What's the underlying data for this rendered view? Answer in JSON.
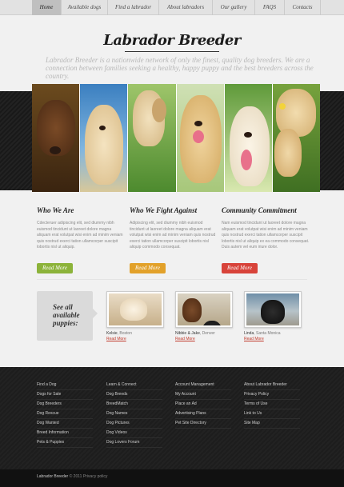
{
  "nav": {
    "items": [
      {
        "label": "Home",
        "active": true
      },
      {
        "label": "Available dogs"
      },
      {
        "label": "Find a labrador"
      },
      {
        "label": "About labradors"
      },
      {
        "label": "Our gallery"
      },
      {
        "label": "FAQS"
      },
      {
        "label": "Contacts"
      }
    ]
  },
  "header": {
    "logo": "Labrador Breeder",
    "tagline": "Labrador Breeder is a nationwide network of only the finest, quality dog breeders. We are a connection between families seeking a healthy, happy puppy and the best breeders across the country."
  },
  "columns": [
    {
      "title": "Who We Are",
      "text": "Cdecteruer adipiscing elit, sed diummy nibh euismod tincidunt ut laoreet dolore magna aliquam erat volutpat wisi enim ad minim veniam quis nostrud exerci tation ullamcorper suscipit lobortis nisl ut aliquip.",
      "button": "Read More",
      "color": "#8cb33a"
    },
    {
      "title": "Who We Fight Against",
      "text": "Adipiscing elit, sed diummy nibh euismod tincidunt ut laoreet dolore magna aliquam erat volutpat wisi enim ad minim veniam quis nostrud exerci tation ullamcorper suscipit lobortis nisl aliquip commodo consequat.",
      "button": "Read More",
      "color": "#e2a12a"
    },
    {
      "title": "Community Commitment",
      "text": "Nam euismod tincidunt ut laoreet dolore magna aliquam erat volutpat wisi enim ad minim veniam quis nostrud exerci tation ullamcorper suscipit lobortis nisl ut aliquip ex ea commodo consequat. Duis autem vel eum iriure dolor.",
      "button": "Read More",
      "color": "#d8433a"
    }
  ],
  "puppies": {
    "heading": "See all available puppies:",
    "items": [
      {
        "name": "Kelsie",
        "location": "Boston",
        "more": "Read More"
      },
      {
        "name": "Nibbie & Jake",
        "location": "Denver",
        "more": "Read More"
      },
      {
        "name": "Linda",
        "location": "Santa Monica",
        "more": "Read More"
      }
    ]
  },
  "footer": {
    "columns": [
      [
        "Find a Dog",
        "Dogs for Sale",
        "Dog Breeders",
        "Dog Rescue",
        "Dog Wanted",
        "Breed Information",
        "Pets & Puppies"
      ],
      [
        "Learn & Connect",
        "Dog Breeds",
        "BreedMatch",
        "Dog Names",
        "Dog Pictures",
        "Dog Videos",
        "Dog Lovers Forum"
      ],
      [
        "Account Management",
        "My Account",
        "Place an Ad",
        "Advertising Plans",
        "Pet Site Directory"
      ],
      [
        "About Labrador Breeder",
        "Privacy Policy",
        "Terms of Use",
        "Link to Us",
        "Site Map"
      ]
    ],
    "copyright_name": "Labrador Breeder",
    "copyright_rest": "© 2011",
    "privacy": "Privacy policy"
  },
  "colors": {
    "accent_green": "#8cb33a",
    "accent_orange": "#e2a12a",
    "accent_red": "#d8433a",
    "link_red": "#c0392b"
  }
}
